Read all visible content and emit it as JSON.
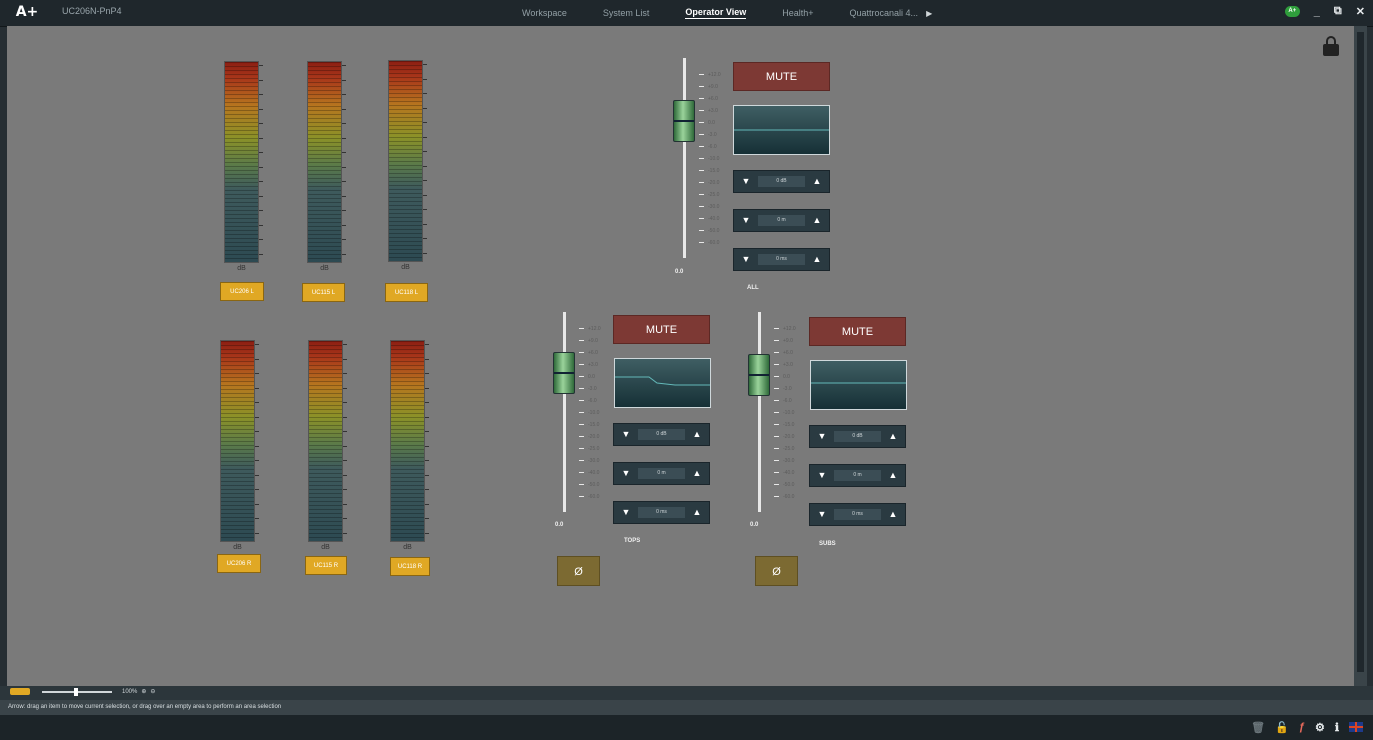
{
  "app": {
    "logo": "A+",
    "project": "UC206N-PnP4"
  },
  "nav": {
    "tabs": [
      "Workspace",
      "System List",
      "Operator View",
      "Health+",
      "Quattrocanali 4..."
    ],
    "active": "Operator View"
  },
  "window_controls": {
    "status": "A+",
    "minimize": "_",
    "restore": "⧉",
    "close": "✕"
  },
  "meters": [
    {
      "unit": "dB",
      "label": "UC206 L"
    },
    {
      "unit": "dB",
      "label": "UC115 L"
    },
    {
      "unit": "dB",
      "label": "UC118 L"
    },
    {
      "unit": "dB",
      "label": "UC206 R"
    },
    {
      "unit": "dB",
      "label": "UC115 R"
    },
    {
      "unit": "dB",
      "label": "UC118 R"
    }
  ],
  "meter_scale": [
    "10",
    "6",
    "3",
    "0",
    "-3",
    "-6",
    "-10",
    "-15",
    "-20",
    "-25",
    "-30",
    "-40",
    "-50",
    "-60"
  ],
  "fader_scale": [
    "+12.0",
    "+9.0",
    "+6.0",
    "+3.0",
    "0.0",
    "-3.0",
    "-6.0",
    "-10.0",
    "-15.0",
    "-20.0",
    "-25.0",
    "-30.0",
    "-40.0",
    "-50.0",
    "-60.0"
  ],
  "groups": [
    {
      "name": "ALL",
      "fader_value": "0.0",
      "mute": "MUTE",
      "gain": "0 dB",
      "delay": "0 m",
      "delay_ms": "0 ms",
      "eq_colors": [
        "#63b8b8"
      ]
    },
    {
      "name": "TOPS",
      "fader_value": "0.0",
      "mute": "MUTE",
      "gain": "0 dB",
      "delay": "0 m",
      "delay_ms": "0 ms",
      "phase": "Ø",
      "eq_colors": [
        "#63b8b8"
      ]
    },
    {
      "name": "SUBS",
      "fader_value": "0.0",
      "mute": "MUTE",
      "gain": "0 dB",
      "delay": "0 m",
      "delay_ms": "0 ms",
      "phase": "Ø",
      "eq_colors": [
        "#63b8b8"
      ]
    }
  ],
  "stepper_icons": {
    "down": "▼",
    "up": "▲"
  },
  "zoom": {
    "level": "100%"
  },
  "status_text": "Arrow: drag an item to move current selection, or drag over an empty area to perform an area selection",
  "colors": {
    "mute": "#7d3934",
    "channel_button": "#e0a824",
    "phase": "#7c6a32",
    "canvas": "#7a7a7a",
    "chrome": "#1f272c"
  }
}
